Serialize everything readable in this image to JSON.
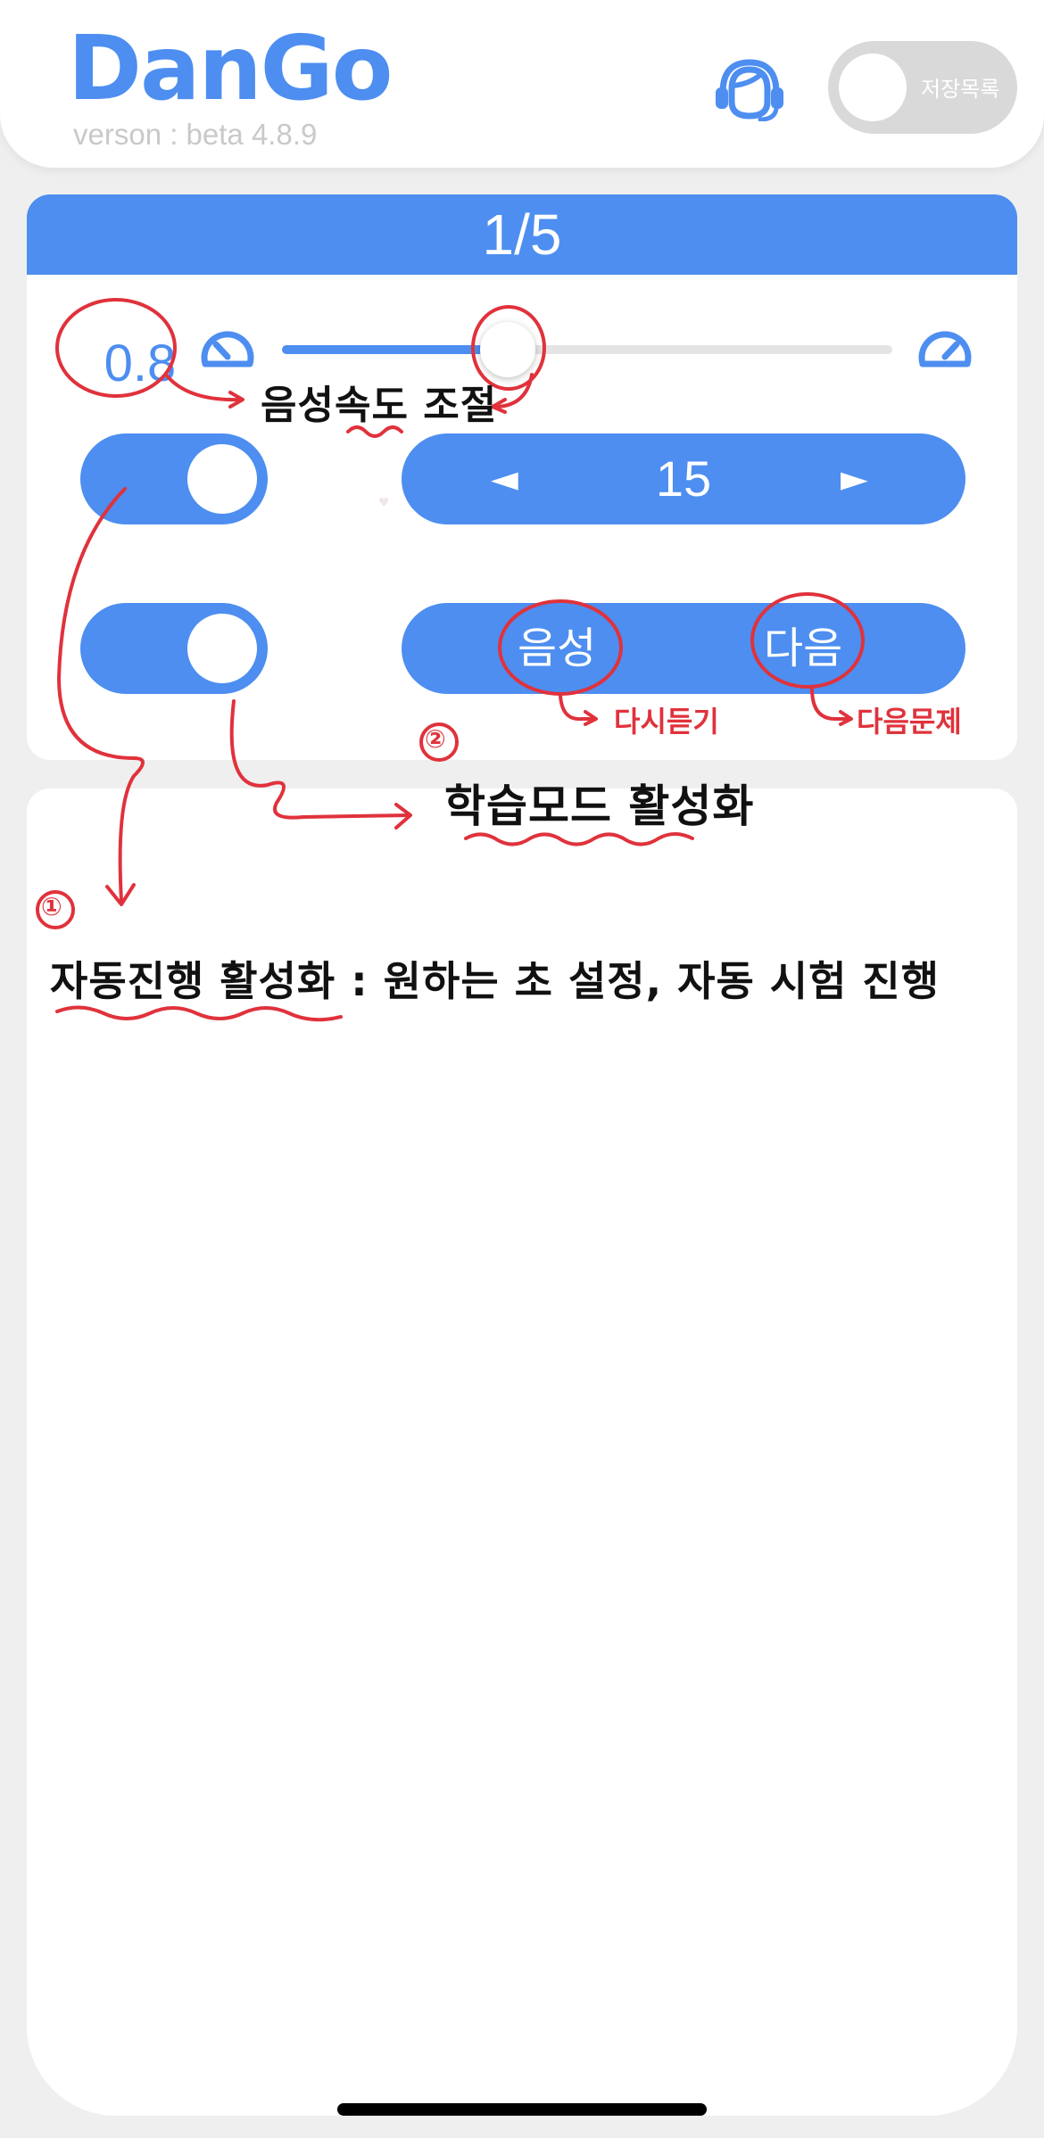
{
  "header": {
    "logo": "DanGo",
    "version": "verson : beta 4.8.9",
    "support_icon": "headset-icon",
    "save_toggle_label": "저장목록"
  },
  "controls": {
    "page_indicator": "1/5",
    "speed": {
      "value": "0.8",
      "level": 0.37,
      "slow_icon": "speedometer-slow-icon",
      "fast_icon": "speedometer-fast-icon"
    },
    "auto_toggle_on": true,
    "study_toggle_on": true,
    "seconds": {
      "prev_label": "◄",
      "value": "15",
      "next_label": "►"
    },
    "actions": {
      "voice_label": "음성",
      "next_label": "다음"
    }
  },
  "annotations": {
    "speed_note": "음성속도 조절",
    "voice_note": "다시듣기",
    "next_note": "다음문제",
    "num1": "①",
    "num2": "②",
    "study_note": "학습모드 활성화",
    "auto_note": "자동진행 활성화 : 원하는 초 설정, 자동 시험 진행"
  },
  "colors": {
    "accent": "#4d8ef0",
    "annotation_red": "#e0323c",
    "background": "#efefef"
  }
}
